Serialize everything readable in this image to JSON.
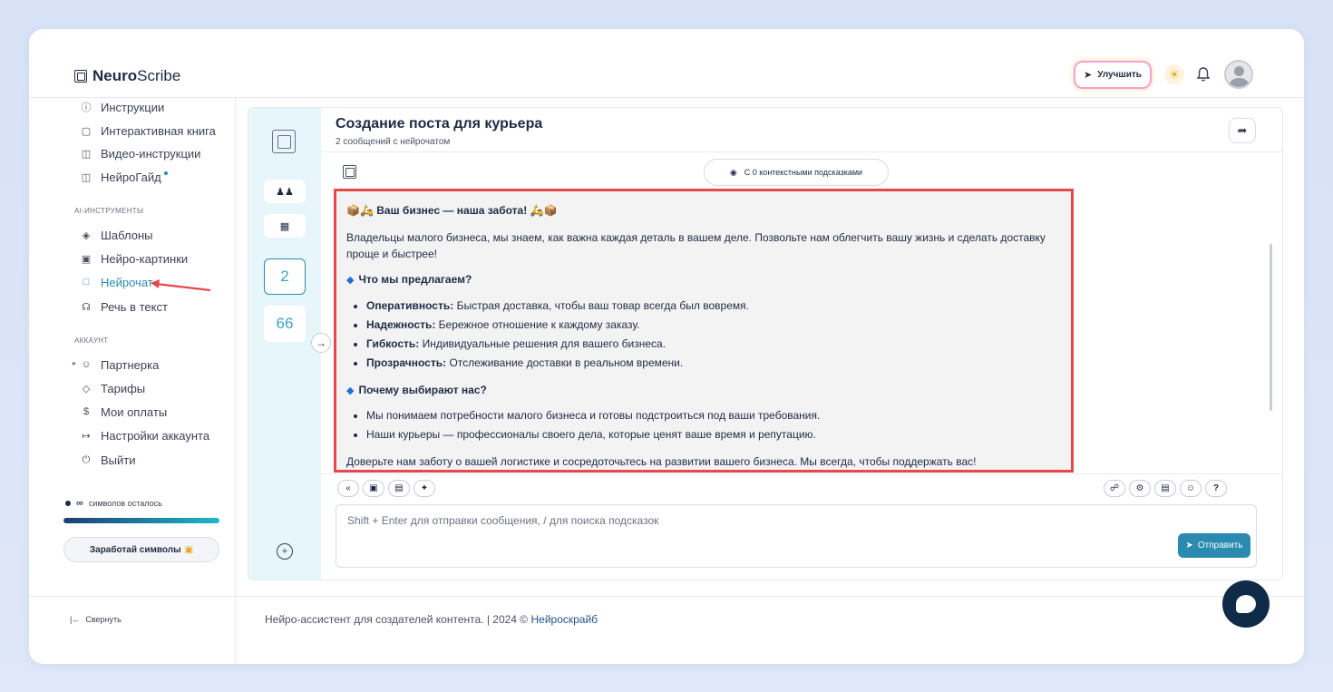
{
  "header": {
    "logo_bold": "Neuro",
    "logo_rest": "Scribe",
    "upgrade_label": "Улучшить"
  },
  "sidebar": {
    "items_top": [
      {
        "label": "Инструкции",
        "icon": "help-circle-icon"
      },
      {
        "label": "Интерактивная книга",
        "icon": "book-icon"
      },
      {
        "label": "Видео-инструкции",
        "icon": "video-icon"
      },
      {
        "label": "НейроГайд",
        "icon": "layout-icon"
      }
    ],
    "ai_tools_label": "AI-ИНСТРУМЕНТЫ",
    "items_ai": [
      {
        "label": "Шаблоны",
        "icon": "layers-icon"
      },
      {
        "label": "Нейро-картинки",
        "icon": "image-icon"
      },
      {
        "label": "Нейрочат",
        "icon": "chat-icon"
      },
      {
        "label": "Речь в текст",
        "icon": "headphones-icon"
      }
    ],
    "account_label": "АККАУНТ",
    "items_account": [
      {
        "label": "Партнерка",
        "icon": "users-icon"
      },
      {
        "label": "Тарифы",
        "icon": "tag-icon"
      },
      {
        "label": "Мои оплаты",
        "icon": "dollar-icon"
      },
      {
        "label": "Настройки аккаунта",
        "icon": "sign-in-icon"
      },
      {
        "label": "Выйти",
        "icon": "power-icon"
      }
    ],
    "symbols_infinity": "∞",
    "symbols_label": "символов осталось",
    "symbols_progress": 1.0,
    "earn_label": "Заработай символы",
    "collapse_label": "Свернуть"
  },
  "rail": {
    "count_selected": "2",
    "count_other": "66"
  },
  "chat": {
    "title": "Создание поста для курьера",
    "subtitle": "2 сообщений с нейрочатом",
    "context_pill": "С 0 контекстными подсказками",
    "message": {
      "heading": "Ваш бизнес — наша забота!",
      "intro": "Владельцы малого бизнеса, мы знаем, как важна каждая деталь в вашем деле. Позвольте нам облегчить вашу жизнь и сделать доставку проще и быстрее!",
      "section1": "Что мы предлагаем?",
      "offers": [
        {
          "term": "Оперативность:",
          "text": " Быстрая доставка, чтобы ваш товар всегда был вовремя."
        },
        {
          "term": "Надежность:",
          "text": " Бережное отношение к каждому заказу."
        },
        {
          "term": "Гибкость:",
          "text": " Индивидуальные решения для вашего бизнеса."
        },
        {
          "term": "Прозрачность:",
          "text": " Отслеживание доставки в реальном времени."
        }
      ],
      "section2": "Почему выбирают нас?",
      "reasons": [
        "Мы понимаем потребности малого бизнеса и готовы подстроиться под ваши требования.",
        "Наши курьеры — профессионалы своего дела, которые ценят ваше время и репутацию."
      ],
      "closing": "Доверьте нам заботу о вашей логистике и сосредоточьтесь на развитии вашего бизнеса. Мы всегда, чтобы поддержать вас!"
    },
    "input_placeholder": "Shift + Enter для отправки сообщения, / для поиска подсказок",
    "send_label": "Отправить",
    "help_label": "?"
  },
  "footer": {
    "text": "Нейро-ассистент для создателей контента.  | 2024 © ",
    "link": "Нейроскрайб"
  },
  "colors": {
    "accent": "#2a8ab0",
    "highlight_border": "#e5484d",
    "rail_bg": "#e6f6fb",
    "fab_bg": "#0f2b48"
  }
}
